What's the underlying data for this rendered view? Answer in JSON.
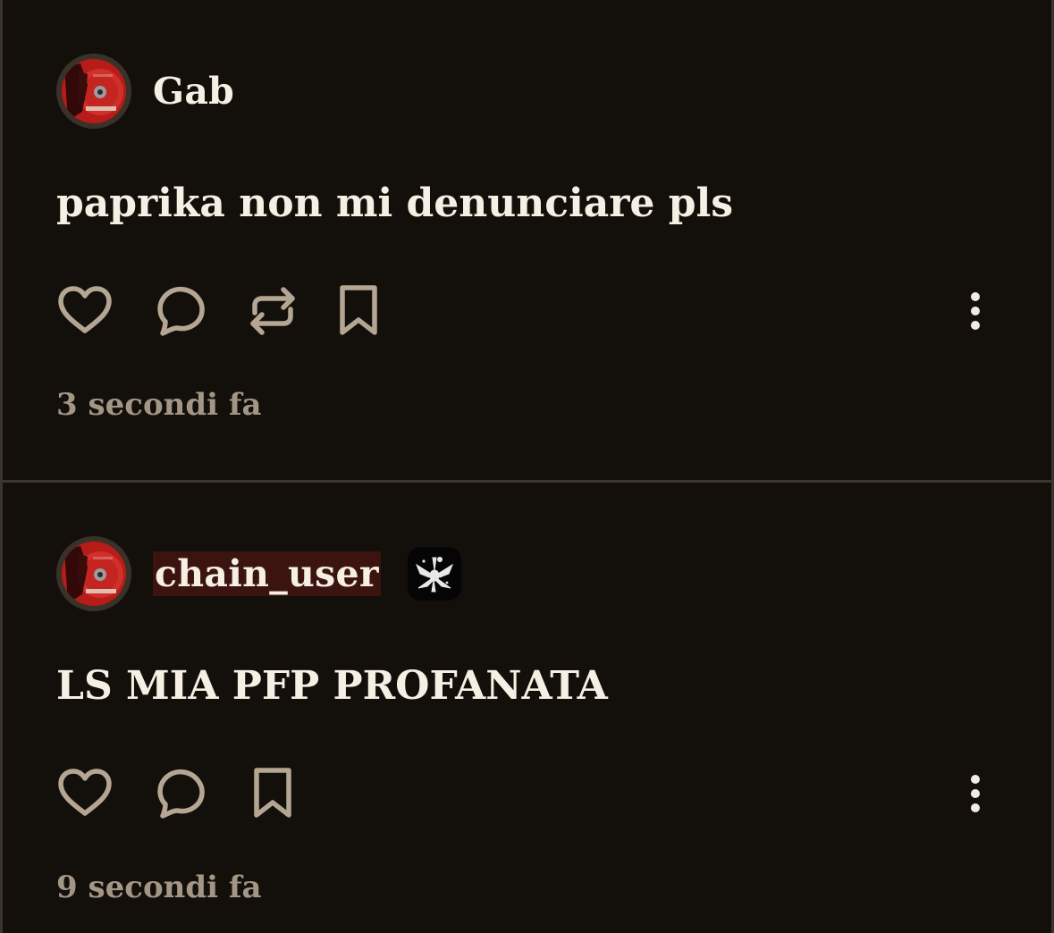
{
  "posts": [
    {
      "username": "Gab",
      "text": "paprika non mi denunciare pls",
      "timestamp": "3 secondi fa",
      "actions": [
        "heart-icon",
        "comment-icon",
        "repost-icon",
        "bookmark-icon"
      ]
    },
    {
      "username": "chain_user",
      "text": "LS MIA PFP PROFANATA",
      "timestamp": "9 secondi fa",
      "actions": [
        "heart-icon",
        "comment-icon",
        "bookmark-icon"
      ]
    }
  ],
  "colors": {
    "background": "#13100c",
    "divider": "#3d362c",
    "text": "#f6efe3",
    "muted": "#a49684",
    "icon": "#b4a692",
    "highlight": "#3b1410",
    "avatar_red": "#c0201c"
  }
}
